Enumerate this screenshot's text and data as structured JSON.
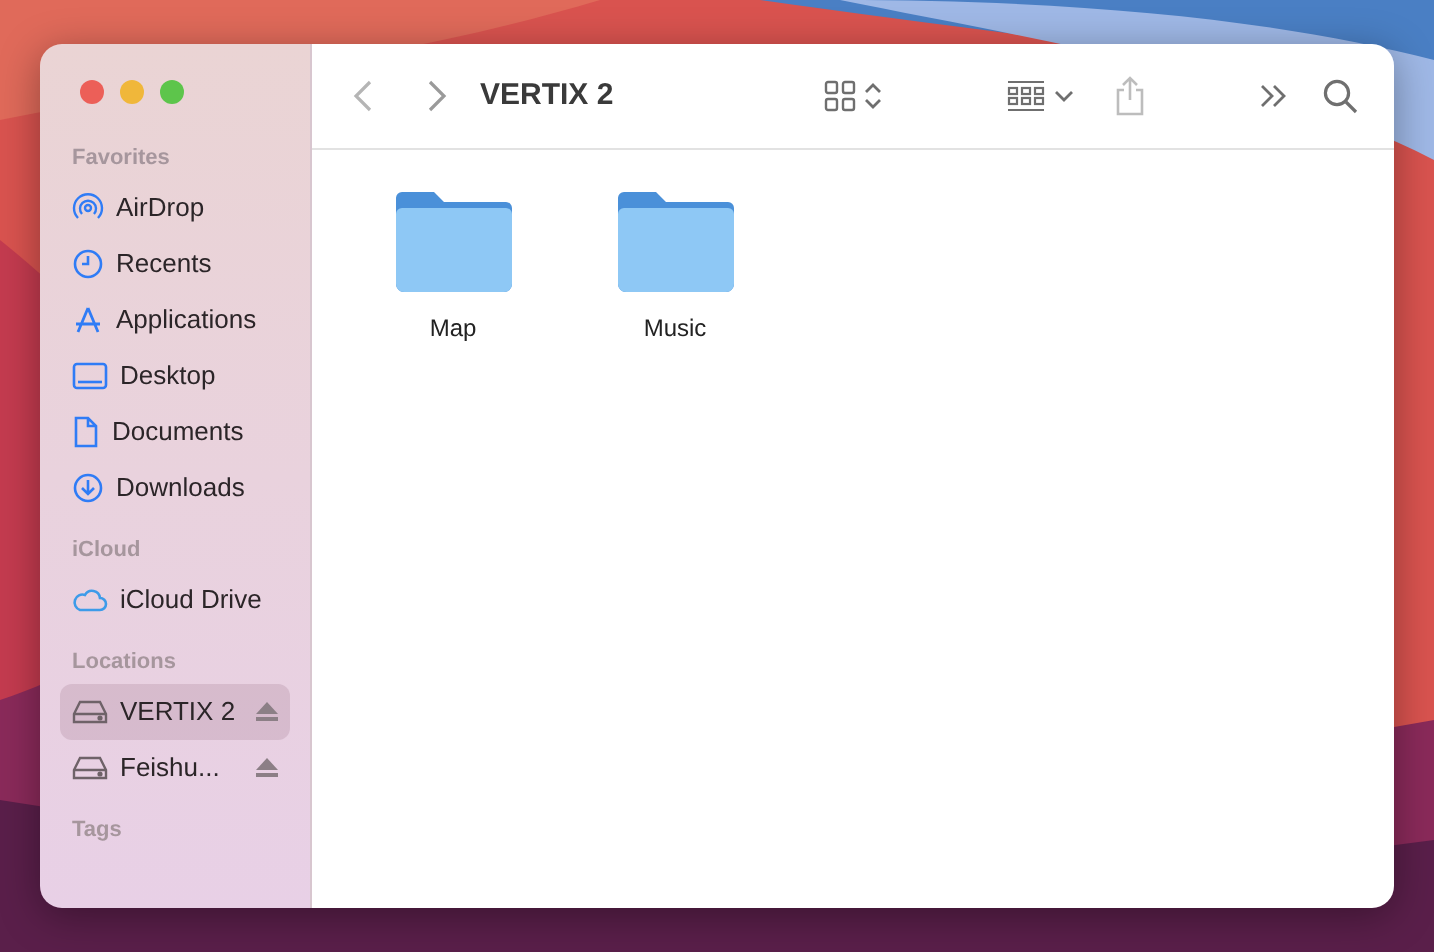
{
  "window": {
    "title": "VERTIX 2"
  },
  "sidebar": {
    "sections": [
      {
        "heading": "Favorites",
        "items": [
          {
            "label": "AirDrop",
            "kind": "airdrop",
            "selected": false,
            "eject": false
          },
          {
            "label": "Recents",
            "kind": "clock",
            "selected": false,
            "eject": false
          },
          {
            "label": "Applications",
            "kind": "apps",
            "selected": false,
            "eject": false
          },
          {
            "label": "Desktop",
            "kind": "desktop",
            "selected": false,
            "eject": false
          },
          {
            "label": "Documents",
            "kind": "document",
            "selected": false,
            "eject": false
          },
          {
            "label": "Downloads",
            "kind": "download",
            "selected": false,
            "eject": false
          }
        ]
      },
      {
        "heading": "iCloud",
        "items": [
          {
            "label": "iCloud Drive",
            "kind": "cloud",
            "selected": false,
            "eject": false
          }
        ]
      },
      {
        "heading": "Locations",
        "items": [
          {
            "label": "VERTIX 2",
            "kind": "drive",
            "selected": true,
            "eject": true
          },
          {
            "label": "Feishu...",
            "kind": "drive",
            "selected": false,
            "eject": true
          }
        ]
      },
      {
        "heading": "Tags"
      }
    ]
  },
  "toolbar": {
    "share_disabled": true
  },
  "files": [
    {
      "name": "Map",
      "kind": "folder"
    },
    {
      "name": "Music",
      "kind": "folder"
    }
  ]
}
